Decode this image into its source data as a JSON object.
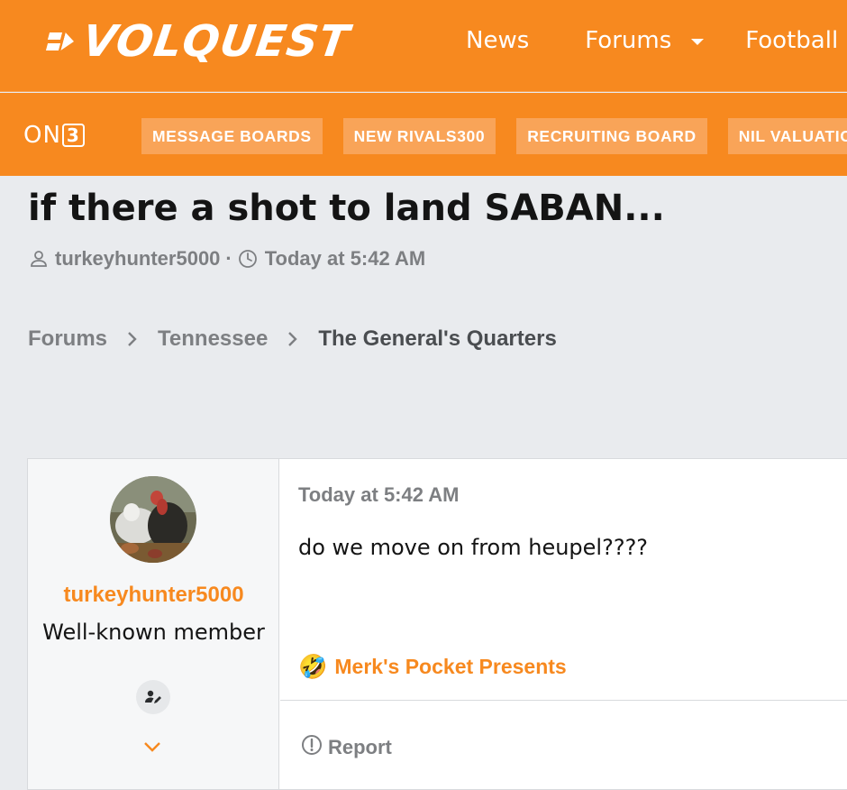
{
  "header": {
    "logo_text": "VOLQUEST",
    "nav": [
      "News",
      "Forums",
      "Football"
    ],
    "brand_color": "#f7891f"
  },
  "subnav": {
    "brand": "ON3",
    "pills": [
      "MESSAGE BOARDS",
      "NEW RIVALS300",
      "RECRUITING BOARD",
      "NIL VALUATION"
    ]
  },
  "thread": {
    "title": "if there a shot to land SABAN...",
    "author": "turkeyhunter5000",
    "separator": "·",
    "time": "Today at 5:42 AM"
  },
  "breadcrumb": [
    "Forums",
    "Tennessee",
    "The General's Quarters"
  ],
  "post": {
    "username": "turkeyhunter5000",
    "user_title": "Well-known member",
    "date": "Today at 5:42 AM",
    "body": "do we move on from heupel????",
    "signature": "Merk's Pocket Presents",
    "signature_emoji": "🤣",
    "report_label": "Report"
  }
}
